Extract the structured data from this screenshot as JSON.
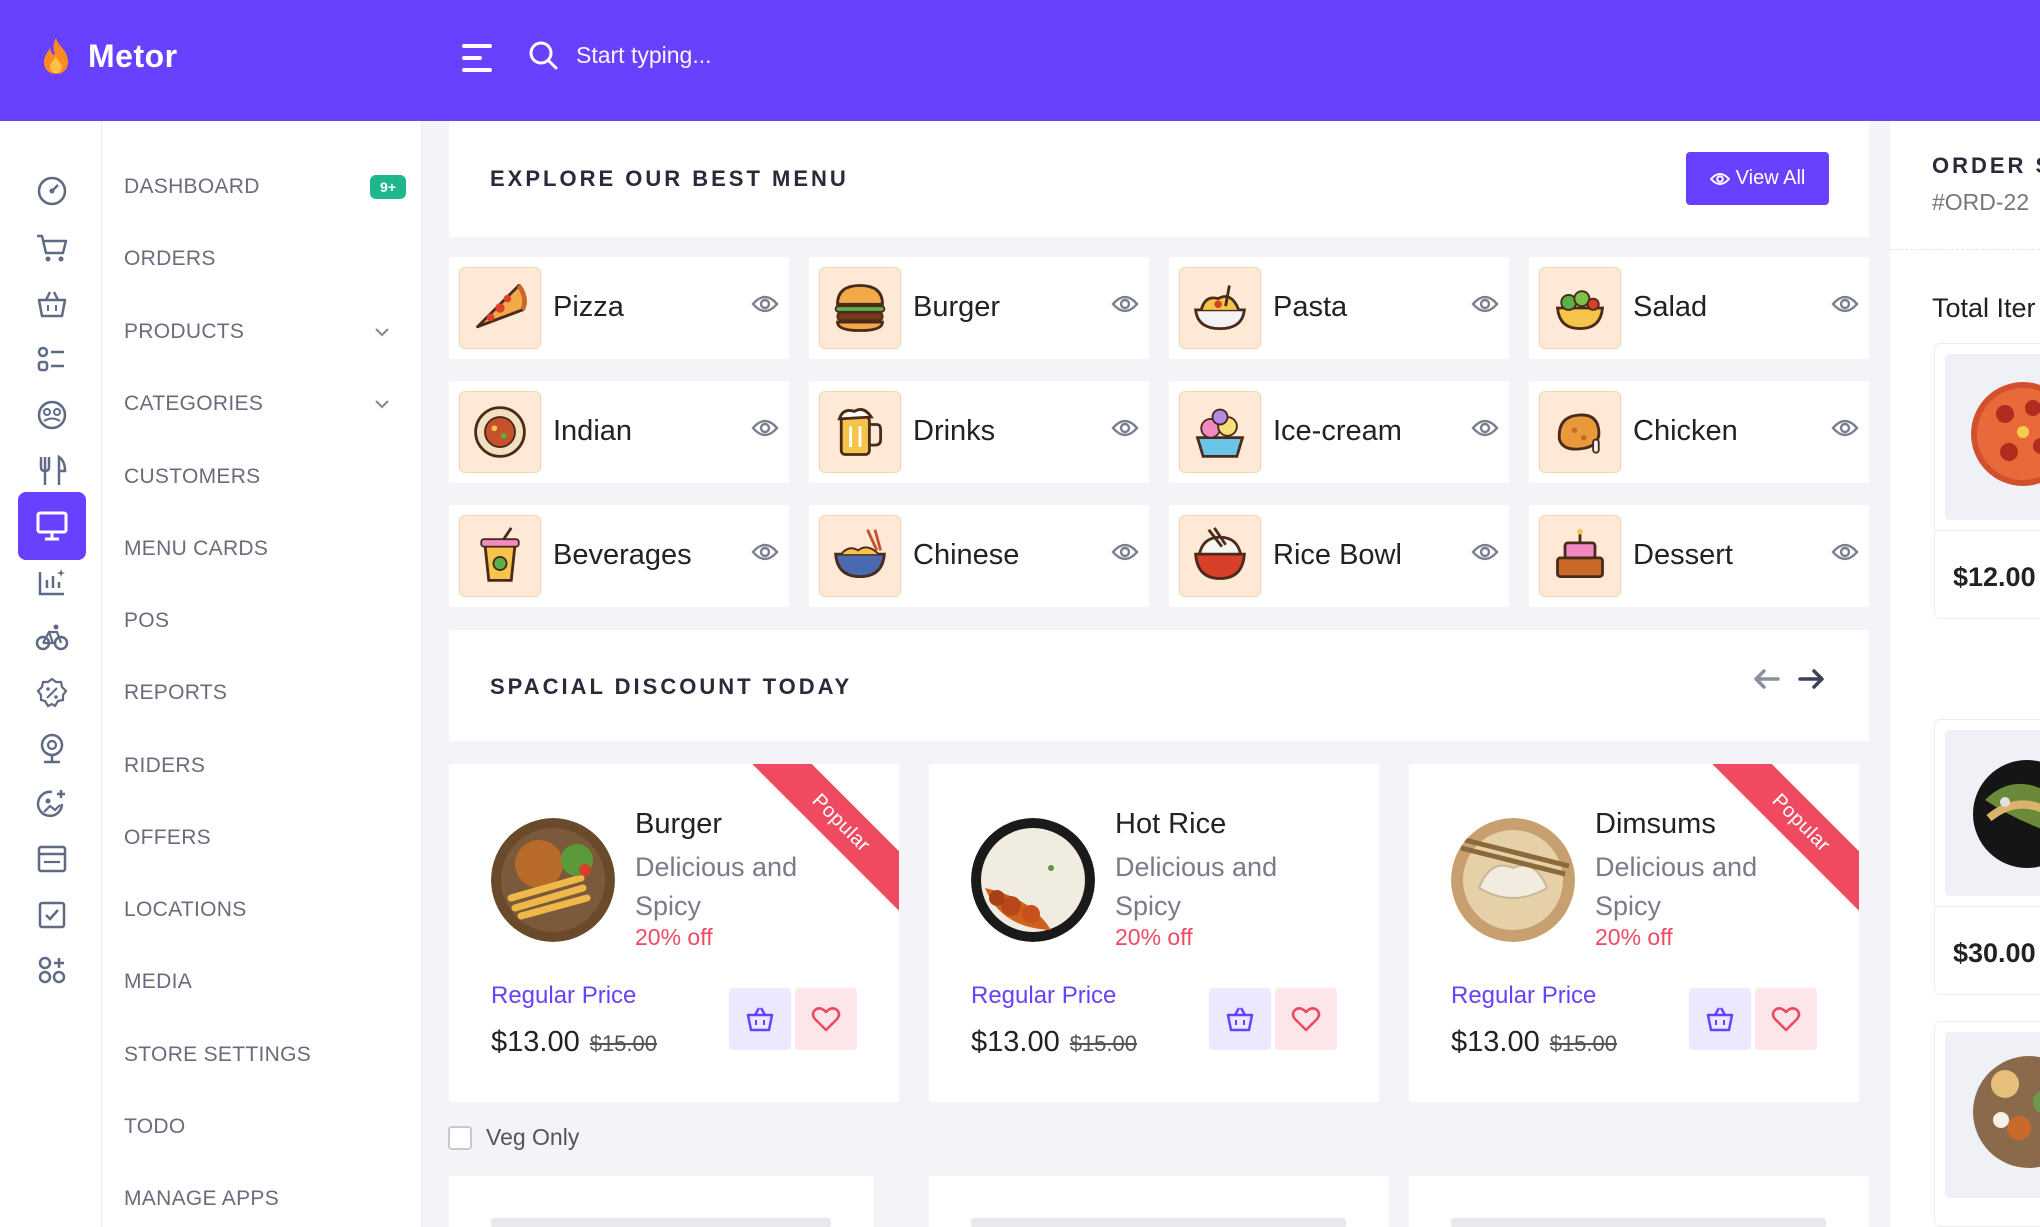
{
  "app": {
    "name": "Metor"
  },
  "search": {
    "placeholder": "Start typing..."
  },
  "nav": {
    "items": [
      {
        "label": "DASHBOARD",
        "badge": "9+"
      },
      {
        "label": "ORDERS"
      },
      {
        "label": "PRODUCTS",
        "chevron": true
      },
      {
        "label": "CATEGORIES",
        "chevron": true
      },
      {
        "label": "CUSTOMERS"
      },
      {
        "label": "MENU CARDS"
      },
      {
        "label": "POS",
        "active": true
      },
      {
        "label": "REPORTS"
      },
      {
        "label": "RIDERS"
      },
      {
        "label": "OFFERS"
      },
      {
        "label": "LOCATIONS"
      },
      {
        "label": "MEDIA"
      },
      {
        "label": "STORE SETTINGS"
      },
      {
        "label": "TODO"
      },
      {
        "label": "MANAGE APPS"
      }
    ]
  },
  "menu": {
    "title": "EXPLORE OUR BEST MENU",
    "view_all": "View All",
    "categories": [
      {
        "name": "Pizza",
        "icon": "pizza-icon"
      },
      {
        "name": "Burger",
        "icon": "burger-icon"
      },
      {
        "name": "Pasta",
        "icon": "pasta-icon"
      },
      {
        "name": "Salad",
        "icon": "salad-icon"
      },
      {
        "name": "Indian",
        "icon": "indian-icon"
      },
      {
        "name": "Drinks",
        "icon": "beer-icon"
      },
      {
        "name": "Ice-cream",
        "icon": "ice-cream-icon"
      },
      {
        "name": "Chicken",
        "icon": "chicken-icon"
      },
      {
        "name": "Beverages",
        "icon": "beverage-icon"
      },
      {
        "name": "Chinese",
        "icon": "noodle-icon"
      },
      {
        "name": "Rice Bowl",
        "icon": "rice-bowl-icon"
      },
      {
        "name": "Dessert",
        "icon": "dessert-icon"
      }
    ]
  },
  "discount": {
    "title": "SPACIAL DISCOUNT TODAY",
    "deals": [
      {
        "name": "Burger",
        "desc": "Delicious and Spicy",
        "off": "20% off",
        "regular_label": "Regular Price",
        "price": "$13.00",
        "old_price": "$15.00",
        "ribbon": "Popular"
      },
      {
        "name": "Hot Rice",
        "desc": "Delicious and Spicy",
        "off": "20% off",
        "regular_label": "Regular Price",
        "price": "$13.00",
        "old_price": "$15.00",
        "ribbon": ""
      },
      {
        "name": "Dimsums",
        "desc": "Delicious and Spicy",
        "off": "20% off",
        "regular_label": "Regular Price",
        "price": "$13.00",
        "old_price": "$15.00",
        "ribbon": "Popular"
      }
    ]
  },
  "filter": {
    "veg_only": "Veg Only"
  },
  "order": {
    "title": "ORDER S",
    "id": "#ORD-22",
    "total_label": "Total Iter",
    "items": [
      {
        "price": "$12.00"
      },
      {
        "price": "$30.00"
      },
      {
        "price": ""
      }
    ]
  },
  "colors": {
    "accent": "#6741ff",
    "danger": "#ef4a5f",
    "success": "#1fb58f",
    "thumb_bg": "#fde9d6"
  }
}
